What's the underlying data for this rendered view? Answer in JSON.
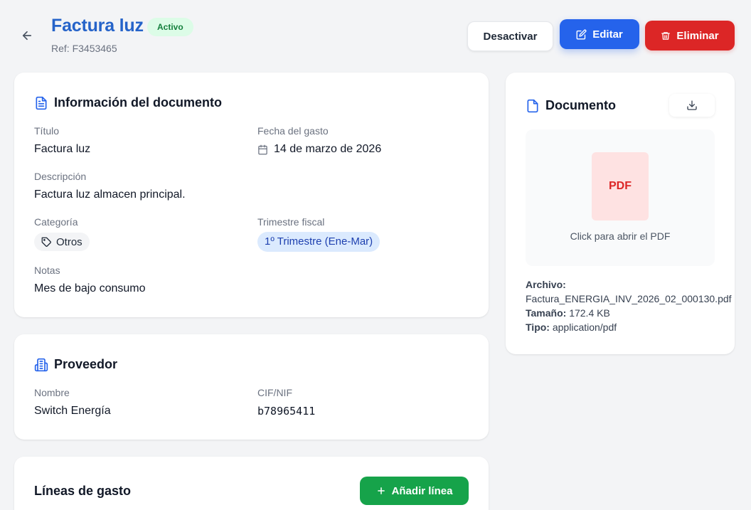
{
  "header": {
    "title": "Factura luz",
    "status": "Activo",
    "ref": "Ref: F3453465",
    "buttons": {
      "deactivate": "Desactivar",
      "edit": "Editar",
      "delete": "Eliminar"
    }
  },
  "info": {
    "title": "Información del documento",
    "titulo_label": "Título",
    "titulo_value": "Factura luz",
    "fecha_label": "Fecha del gasto",
    "fecha_value": "14 de marzo de 2026",
    "descripcion_label": "Descripción",
    "descripcion_value": "Factura luz almacen principal.",
    "categoria_label": "Categoría",
    "categoria_value": "Otros",
    "trimestre_label": "Trimestre fiscal",
    "trimestre_value": "1º Trimestre (Ene-Mar)",
    "notas_label": "Notas",
    "notas_value": "Mes de bajo consumo"
  },
  "supplier": {
    "title": "Proveedor",
    "nombre_label": "Nombre",
    "nombre_value": "Switch Energía",
    "cif_label": "CIF/NIF",
    "cif_value": "b78965411"
  },
  "lines": {
    "title": "Líneas de gasto",
    "add_button": "Añadir línea"
  },
  "document": {
    "title": "Documento",
    "pdf_label": "PDF",
    "open_text": "Click para abrir el PDF",
    "archivo_label": "Archivo:",
    "archivo_value": "Factura_ENERGIA_INV_2026_02_000130.pdf",
    "tamano_label": "Tamaño:",
    "tamano_value": "172.4 KB",
    "tipo_label": "Tipo:",
    "tipo_value": "application/pdf"
  },
  "icons": [
    "arrow-left-icon",
    "edit-icon",
    "trash-icon",
    "document-icon",
    "calendar-icon",
    "tag-icon",
    "building-icon",
    "download-icon",
    "file-icon",
    "plus-icon"
  ],
  "colors": {
    "title_blue": "#2563c9",
    "primary": "#2563eb",
    "danger": "#dc2626",
    "success": "#16a34a",
    "badge_green_bg": "#dcfce7"
  }
}
